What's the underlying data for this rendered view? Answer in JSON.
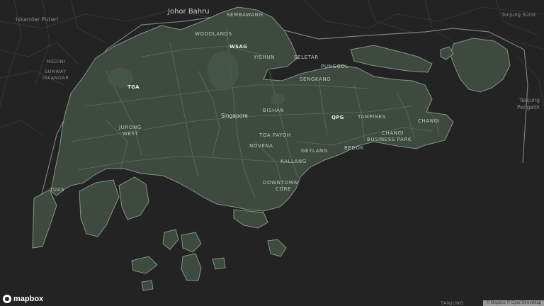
{
  "map": {
    "colors": {
      "sea": "#232323",
      "land": "#3e4a40",
      "land_stroke": "#7f9684",
      "roads": "#5e6f62",
      "boundary": "#7d7d7d"
    },
    "labels": {
      "johor_bahru": "Johor Bahru",
      "iskandar_puteri": "Iskandar Puteri",
      "medini": "MEDINI",
      "sunway_iskandar_1": "SUNWAY",
      "sunway_iskandar_2": "ISKANDAR",
      "tanjung_surat": "Tanjung Surat",
      "tanjung_pengelih_1": "Tanjung",
      "tanjung_pengelih_2": "Pengelih",
      "tanjung_bottom": "TANJUNG",
      "sembawang": "SEMBAWANG",
      "woodlands": "WOODLANDS",
      "wsag": "WSAG",
      "yishun": "YISHUN",
      "seletar": "SELETAR",
      "punggol": "PUNGGOL",
      "sengkang": "SENGKANG",
      "tga": "TGA",
      "singapore": "Singapore",
      "bishan": "BISHAN",
      "qpg": "QPG",
      "tampines": "TAMPINES",
      "changi": "CHANGI",
      "jurong_west_1": "JURONG",
      "jurong_west_2": "WEST",
      "toa_payoh": "TOA PAYOH",
      "novena": "NOVENA",
      "geylang": "GEYLANG",
      "bedok": "BEDOK",
      "changi_bp_1": "CHANGI",
      "changi_bp_2": "BUSINESS PARK",
      "kallang": "KALLANG",
      "downtown_core_1": "DOWNTOWN",
      "downtown_core_2": "CORE",
      "tuas": "TUAS"
    },
    "logo": "mapbox",
    "attribution": "© Mapbox © OpenStreetMap"
  }
}
